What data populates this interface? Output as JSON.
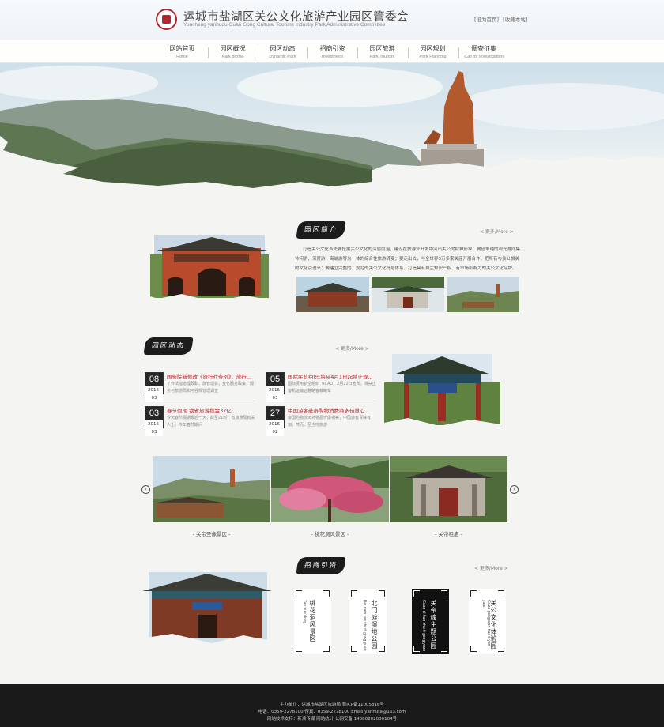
{
  "header": {
    "title": "运城市盐湖区关公文化旅游产业园区管委会",
    "subtitle": "Yuncheng yanhuqu Guan Gong Cultural Tourism Industry Park Administrative Committee",
    "links": [
      "[设为首页]",
      "[收藏本站]"
    ]
  },
  "nav": [
    {
      "cn": "网站首页",
      "en": "Home"
    },
    {
      "cn": "园区概况",
      "en": "Park profile"
    },
    {
      "cn": "园区动态",
      "en": "Dynamic Park"
    },
    {
      "cn": "招商引资",
      "en": "Investment"
    },
    {
      "cn": "园区旅游",
      "en": "Park Tourism"
    },
    {
      "cn": "园区规划",
      "en": "Park Planning"
    },
    {
      "cn": "调查征集",
      "en": "Call for investigation"
    }
  ],
  "intro": {
    "title": "园区简介",
    "more": "< 更多/More >",
    "text": "打造关公文化首先要挖掘关公文化的深层内涵，建议在旅游业开发中突出关公的财神形象；要借单纯的观光游向集休闲游、深度游、高端游等为一体的综合性旅游转变；要走出去，与全世界3万多家关庙开展合作，把所有与关公相关的文化引进来；要建立完整的、规范的关公文化符号体系，打造具有自主知识产权、有市场影响力的关公文化品牌。"
  },
  "news": {
    "title": "园区动态",
    "more": "< 更多/More >",
    "items": [
      {
        "day": "08",
        "ym": "2016-03",
        "title": "国务院新修改《旅行社条例》，旅行...",
        "desc": "了作法措道理政职、款管理会，业化服务政策，服务与旅游局和可强规管理调查"
      },
      {
        "day": "05",
        "ym": "2016-03",
        "title": "国际民航组织:将从4月1日起禁止规...",
        "desc": "国际民用航空组织（ICAO）2月22日宣布，将禁止客机运输远着路客载罐车"
      },
      {
        "day": "03",
        "ym": "2016-03",
        "title": "春节假期 我省旅游揽金37亿",
        "desc": "今天春节假期最后一天，截至21时，省旅游局有关人士：今年春节期间"
      },
      {
        "day": "27",
        "ym": "2016-02",
        "title": "中国游客赴泰购物消费商多轻量心",
        "desc": "泰国的物价天对物品价廉物美，中国游客青睐有加，然而，至当地旅游"
      }
    ]
  },
  "carousel": {
    "prev": "‹",
    "next": "›",
    "captions": [
      "- 关帝圣像景区 -",
      "- 桃花洞风景区 -",
      "- 关帝祖庙 -"
    ]
  },
  "investment": {
    "title": "招商引资",
    "more": "< 更多/More >",
    "cards": [
      {
        "cn": "桃花洞风景区",
        "en": "Tao hua dong",
        "dark": false
      },
      {
        "cn": "北门滩湿地公园",
        "en": "Bei men tan shi di gong yuan",
        "dark": false
      },
      {
        "cn": "关帝魂主题公园",
        "en": "Guan di hun zhu ti gong yuan",
        "dark": true
      },
      {
        "cn": "关公文化体验园",
        "en": "Guan gong wen hua ti yan yuan",
        "dark": false
      }
    ]
  },
  "footer": {
    "lines": [
      "主办单位：运城市盐湖区旅游局 晋ICP备11005816号",
      "电话：0359-2278100 传真：0359-2278100 Email:yanhuta@163.com",
      "网站技术支持：新浪传媒 网站统计 公网安备 14080202000104号"
    ]
  },
  "colors": {
    "accent": "#b02028",
    "footer_bg": "#1a1a1a",
    "brush": "#1c1c1c"
  }
}
